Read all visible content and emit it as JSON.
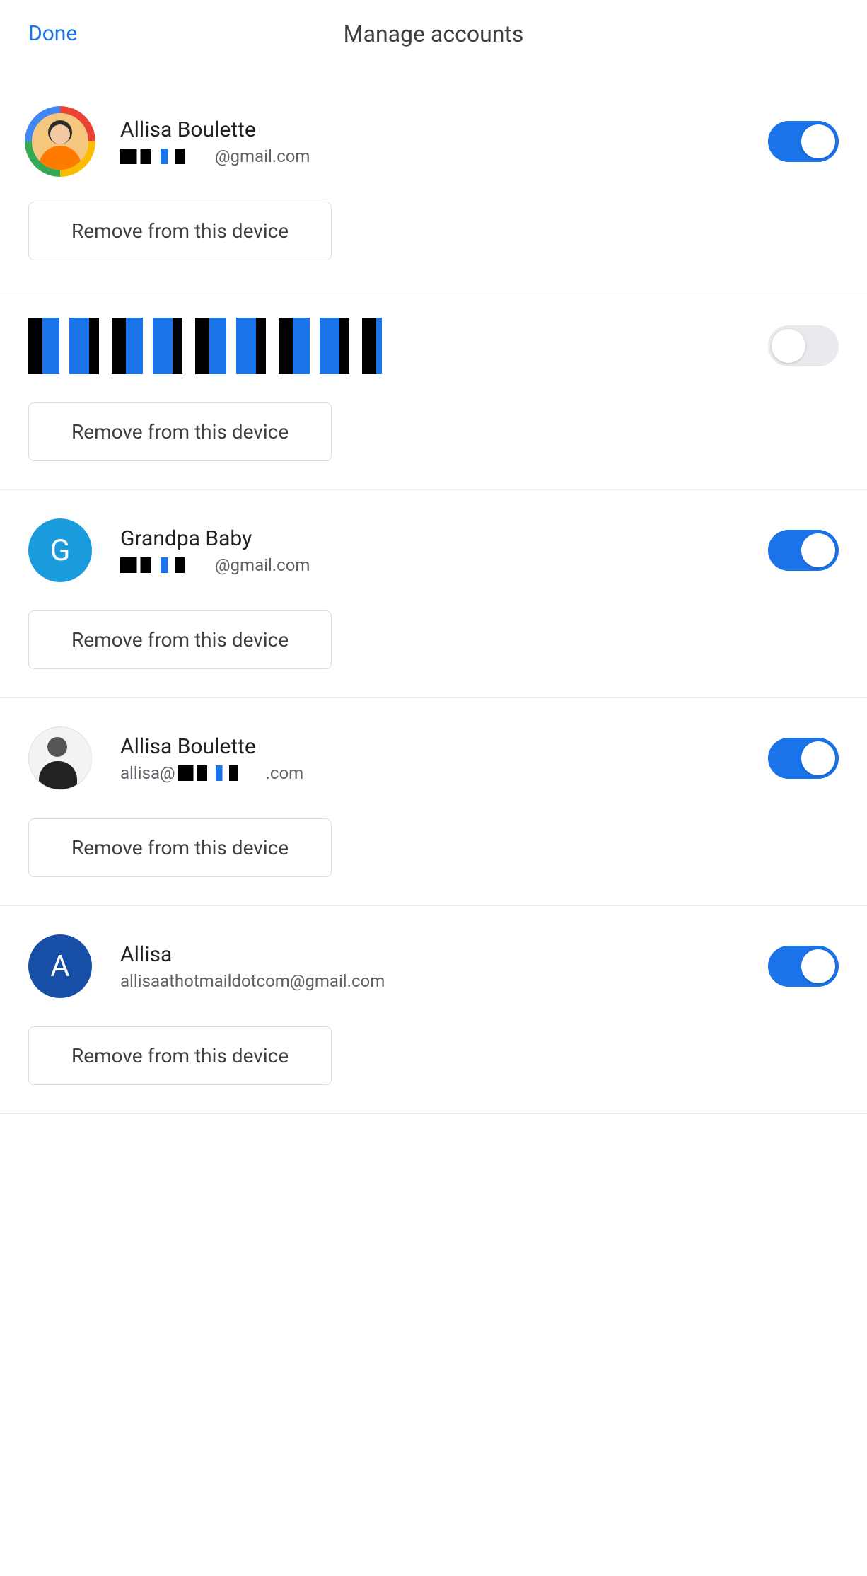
{
  "header": {
    "done_label": "Done",
    "title": "Manage accounts"
  },
  "remove_label": "Remove from this device",
  "accounts": [
    {
      "name": "Allisa Boulette",
      "email_prefix_redacted": true,
      "email_suffix": "@gmail.com",
      "enabled": true,
      "avatar_type": "photo-ring",
      "avatar_letter": "",
      "avatar_bg": ""
    },
    {
      "name": "",
      "fully_redacted": true,
      "enabled": false,
      "avatar_type": "redacted",
      "avatar_letter": "",
      "avatar_bg": ""
    },
    {
      "name": "Grandpa Baby",
      "email_prefix_redacted": true,
      "email_suffix": "@gmail.com",
      "enabled": true,
      "avatar_type": "letter",
      "avatar_letter": "G",
      "avatar_bg": "#1a9bdb"
    },
    {
      "name": "Allisa Boulette",
      "email_prefix": "allisa@",
      "email_mid_redacted": true,
      "email_suffix": ".com",
      "enabled": true,
      "avatar_type": "bw-photo",
      "avatar_letter": "",
      "avatar_bg": ""
    },
    {
      "name": "Allisa",
      "email_full": "allisaathotmaildotcom@gmail.com",
      "enabled": true,
      "avatar_type": "letter",
      "avatar_letter": "A",
      "avatar_bg": "#174ea6"
    }
  ]
}
